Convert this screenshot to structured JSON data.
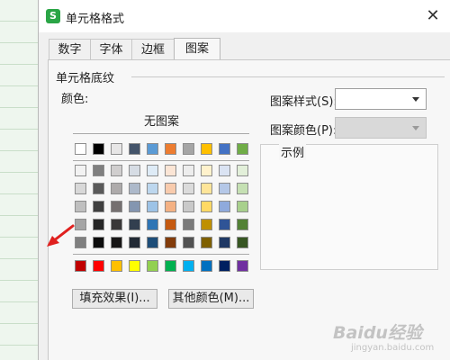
{
  "dialog": {
    "app_icon_letter": "S",
    "title": "单元格格式",
    "close_glyph": "✕"
  },
  "tabs": [
    {
      "label": "数字",
      "active": false
    },
    {
      "label": "字体",
      "active": false
    },
    {
      "label": "边框",
      "active": false
    },
    {
      "label": "图案",
      "active": true
    }
  ],
  "shading": {
    "group_title": "单元格底纹",
    "color_label": "颜色:",
    "no_pattern": "无图案",
    "palette_top": [
      "#ffffff",
      "#000000",
      "#e7e6e6",
      "#44546a",
      "#5b9bd5",
      "#ed7d31",
      "#a5a5a5",
      "#ffc000",
      "#4472c4",
      "#70ad47"
    ],
    "palette_grid": [
      [
        "#f2f2f2",
        "#7f7f7f",
        "#d0cece",
        "#d6dce4",
        "#deebf6",
        "#fbe5d5",
        "#ededed",
        "#fff2cc",
        "#dae3f3",
        "#e2efd9"
      ],
      [
        "#d8d8d8",
        "#595959",
        "#aeabab",
        "#adb9ca",
        "#bdd7ee",
        "#f8cbad",
        "#dbdbdb",
        "#fee599",
        "#b4c7e7",
        "#c5e0b3"
      ],
      [
        "#bfbfbf",
        "#3f3f3f",
        "#757070",
        "#8496b0",
        "#9dc3e6",
        "#f4b183",
        "#c9c9c9",
        "#ffd965",
        "#8faadc",
        "#a8d08d"
      ],
      [
        "#a5a5a5",
        "#262626",
        "#3a3838",
        "#323f4f",
        "#2e75b5",
        "#c55a11",
        "#7b7b7b",
        "#bf9000",
        "#2f5496",
        "#538135"
      ],
      [
        "#7f7f7f",
        "#0c0c0c",
        "#171616",
        "#222a35",
        "#1e4e79",
        "#833c0b",
        "#525252",
        "#7f6000",
        "#1f3864",
        "#375623"
      ]
    ],
    "palette_standard": [
      "#c00000",
      "#ff0000",
      "#ffc000",
      "#ffff00",
      "#92d050",
      "#00b050",
      "#00b0f0",
      "#0070c0",
      "#002060",
      "#7030a0"
    ],
    "fill_effects_button": "填充效果(I)...",
    "more_colors_button": "其他颜色(M)..."
  },
  "pattern": {
    "style_label": "图案样式(S):",
    "color_label": "图案颜色(P):",
    "sample_label": "示例"
  },
  "annotation": {
    "arrow_color": "#e0201e"
  },
  "watermark": {
    "main": "Baidu经验",
    "sub": "jingyan.baidu.com"
  }
}
